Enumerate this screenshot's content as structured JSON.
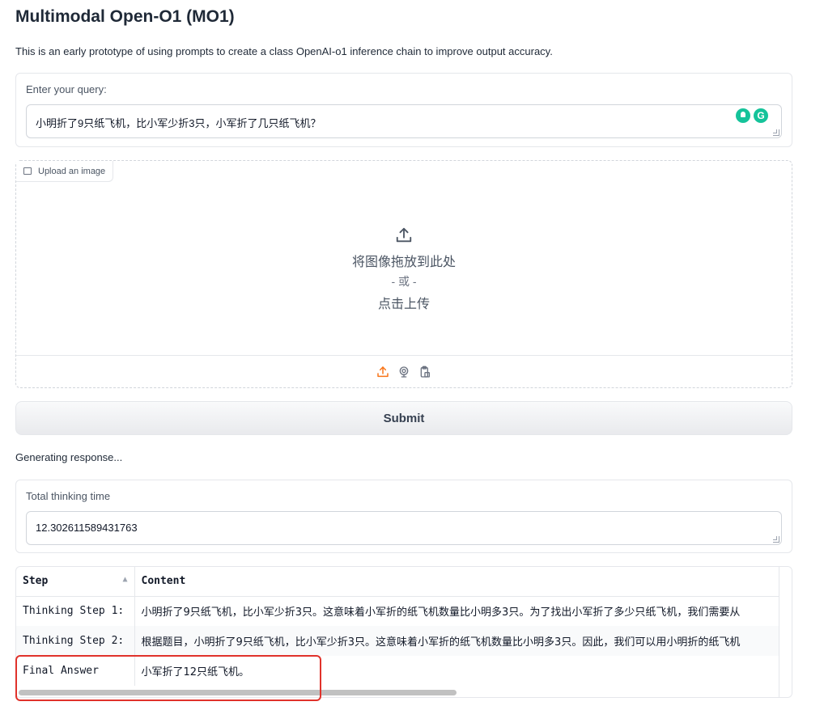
{
  "header": {
    "title": "Multimodal Open-O1 (MO1)",
    "description": "This is an early prototype of using prompts to create a class OpenAI-o1 inference chain to improve output accuracy."
  },
  "query": {
    "label": "Enter your query:",
    "value": "小明折了9只纸飞机，比小军少折3只，小军折了几只纸飞机？"
  },
  "image_upload": {
    "label": "Upload an image",
    "drop_text": "将图像拖放到此处",
    "or_text": "- 或 -",
    "click_text": "点击上传",
    "sources": [
      "upload-icon",
      "webcam-icon",
      "clipboard-icon"
    ],
    "active_color": "#f97316"
  },
  "submit": {
    "label": "Submit"
  },
  "status": {
    "text": "Generating response..."
  },
  "thinking_time": {
    "label": "Total thinking time",
    "value": "12.302611589431763"
  },
  "results_table": {
    "columns": [
      "Step",
      "Content"
    ],
    "rows": [
      {
        "step": "Thinking Step 1:",
        "content": "小明折了9只纸飞机，比小军少折3只。这意味着小军折的纸飞机数量比小明多3只。为了找出小军折了多少只纸飞机，我们需要从"
      },
      {
        "step": "Thinking Step 2:",
        "content": "根据题目，小明折了9只纸飞机，比小军少折3只。这意味着小军折的纸飞机数量比小明多3只。因此，我们可以用小明折的纸飞机"
      },
      {
        "step": "Final Answer",
        "content": "小军折了12只纸飞机。"
      }
    ]
  },
  "highlight_color": "#e0322b"
}
